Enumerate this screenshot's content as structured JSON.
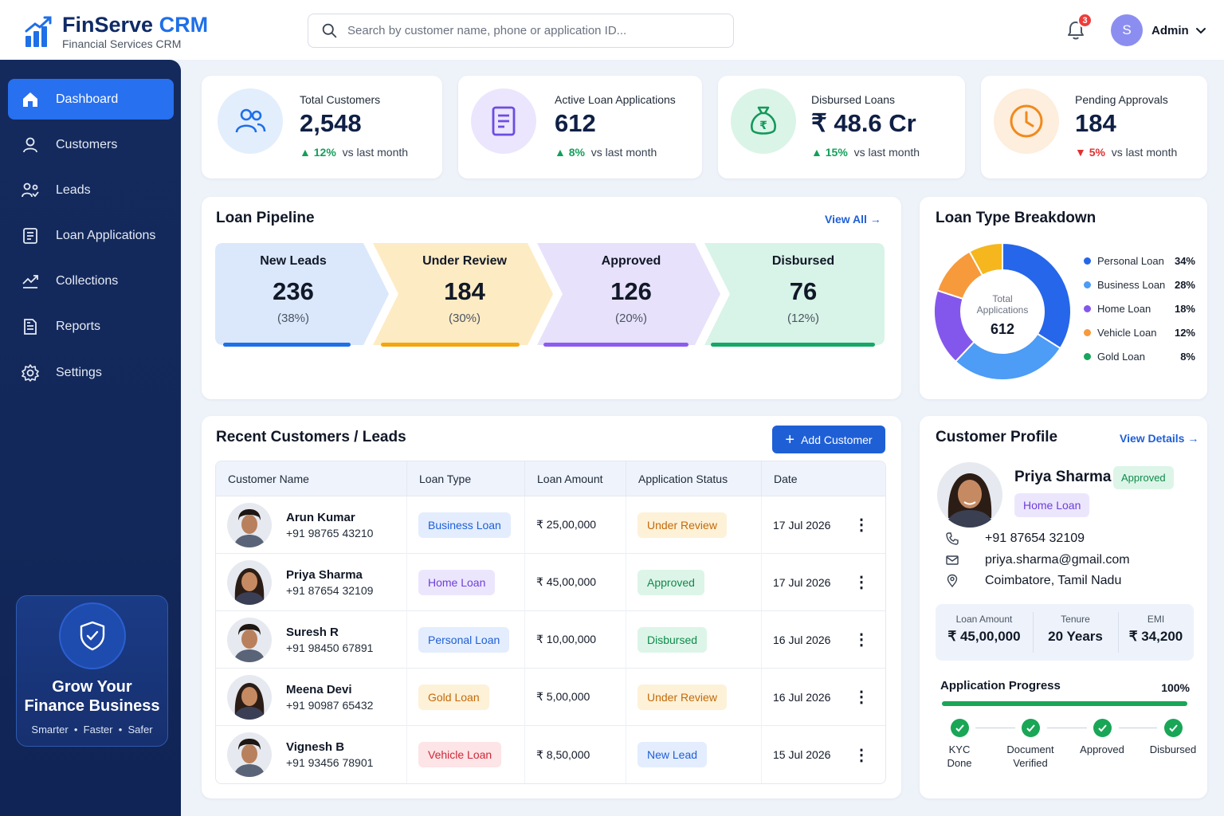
{
  "brand": {
    "name": "FinServe",
    "name_accent": "CRM",
    "subtitle": "Financial Services CRM"
  },
  "search": {
    "placeholder": "Search by customer name, phone or application ID..."
  },
  "header": {
    "notification_count": "3",
    "user_initial": "S",
    "user_name": "Admin"
  },
  "sidebar": {
    "items": [
      {
        "label": "Dashboard",
        "icon": "home-icon",
        "active": true
      },
      {
        "label": "Customers",
        "icon": "user-icon"
      },
      {
        "label": "Leads",
        "icon": "leads-icon"
      },
      {
        "label": "Loan Applications",
        "icon": "document-icon"
      },
      {
        "label": "Collections",
        "icon": "trend-icon"
      },
      {
        "label": "Reports",
        "icon": "report-icon"
      },
      {
        "label": "Settings",
        "icon": "gear-icon"
      }
    ],
    "promo": {
      "title_line1": "Grow Your",
      "title_line2": "Finance Business",
      "subtitle": "Smarter  •  Faster  •  Safer"
    }
  },
  "kpis": [
    {
      "label": "Total Customers",
      "value": "2,548",
      "trend": "12%",
      "trend_dir": "up",
      "trend_text": "vs last month"
    },
    {
      "label": "Active Loan Applications",
      "value": "612",
      "trend": "8%",
      "trend_dir": "up",
      "trend_text": "vs last month"
    },
    {
      "label": "Disbursed Loans",
      "value": "₹ 48.6 Cr",
      "trend": "15%",
      "trend_dir": "up",
      "trend_text": "vs last month"
    },
    {
      "label": "Pending Approvals",
      "value": "184",
      "trend": "5%",
      "trend_dir": "down",
      "trend_text": "vs last month"
    }
  ],
  "pipeline": {
    "title": "Loan Pipeline",
    "link": "View All",
    "stages": [
      {
        "label": "New Leads",
        "value": "236",
        "pct": "(38%)",
        "color": "#1f6fe8"
      },
      {
        "label": "Under Review",
        "value": "184",
        "pct": "(30%)",
        "color": "#f3a70f"
      },
      {
        "label": "Approved",
        "value": "126",
        "pct": "(20%)",
        "color": "#8b5cf0"
      },
      {
        "label": "Disbursed",
        "value": "76",
        "pct": "(12%)",
        "color": "#16a866"
      }
    ]
  },
  "breakdown": {
    "title": "Loan Type Breakdown",
    "center_label_1": "Total",
    "center_label_2": "Applications",
    "center_value": "612"
  },
  "chart_data": {
    "type": "pie",
    "title": "Loan Type Breakdown",
    "categories": [
      "Personal Loan",
      "Business Loan",
      "Home Loan",
      "Vehicle Loan",
      "Gold Loan"
    ],
    "values": [
      34,
      28,
      18,
      12,
      8
    ],
    "labels": [
      "34%",
      "28%",
      "18%",
      "12%",
      "8%"
    ],
    "colors": [
      "#2566ea",
      "#4d9cf5",
      "#8457ec",
      "#f79a3b",
      "#f5b71d"
    ],
    "legend_dots": [
      "#2566ea",
      "#4d9cf5",
      "#8457ec",
      "#f79a3b",
      "#19a55d"
    ]
  },
  "customers": {
    "title": "Recent Customers / Leads",
    "add_button": "Add Customer",
    "columns": [
      "Customer Name",
      "Loan Type",
      "Loan Amount",
      "Application Status",
      "Date"
    ],
    "rows": [
      {
        "name": "Arun Kumar",
        "phone": "+91 98765 43210",
        "loan_type": "Business Loan",
        "loan_class": "p-blue",
        "amount": "₹ 25,00,000",
        "status": "Under Review",
        "status_class": "p-amber",
        "date": "17 Jul 2026",
        "gender": "m"
      },
      {
        "name": "Priya Sharma",
        "phone": "+91 87654 32109",
        "loan_type": "Home Loan",
        "loan_class": "p-purple",
        "amount": "₹ 45,00,000",
        "status": "Approved",
        "status_class": "p-green",
        "date": "17 Jul 2026",
        "gender": "f"
      },
      {
        "name": "Suresh R",
        "phone": "+91 98450 67891",
        "loan_type": "Personal Loan",
        "loan_class": "p-blue",
        "amount": "₹ 10,00,000",
        "status": "Disbursed",
        "status_class": "p-green",
        "date": "16 Jul 2026",
        "gender": "m"
      },
      {
        "name": "Meena Devi",
        "phone": "+91 90987 65432",
        "loan_type": "Gold Loan",
        "loan_class": "p-amber",
        "amount": "₹ 5,00,000",
        "status": "Under Review",
        "status_class": "p-amber",
        "date": "16 Jul 2026",
        "gender": "f"
      },
      {
        "name": "Vignesh B",
        "phone": "+91 93456 78901",
        "loan_type": "Vehicle Loan",
        "loan_class": "p-red",
        "amount": "₹ 8,50,000",
        "status": "New Lead",
        "status_class": "p-blue",
        "date": "15 Jul 2026",
        "gender": "m"
      }
    ]
  },
  "profile": {
    "title": "Customer Profile",
    "link": "View Details",
    "name": "Priya Sharma",
    "status": "Approved",
    "loan_type": "Home Loan",
    "phone": "+91 87654 32109",
    "email": "priya.sharma@gmail.com",
    "location": "Coimbatore, Tamil Nadu",
    "stats": [
      {
        "label": "Loan Amount",
        "value": "₹ 45,00,000"
      },
      {
        "label": "Tenure",
        "value": "20 Years"
      },
      {
        "label": "EMI",
        "value": "₹ 34,200"
      }
    ],
    "progress_label": "Application Progress",
    "progress_pct": "100%",
    "progress_value": 100,
    "steps": [
      {
        "line1": "KYC",
        "line2": "Done"
      },
      {
        "line1": "Document",
        "line2": "Verified"
      },
      {
        "line1": "Approved",
        "line2": ""
      },
      {
        "line1": "Disbursed",
        "line2": ""
      }
    ]
  }
}
